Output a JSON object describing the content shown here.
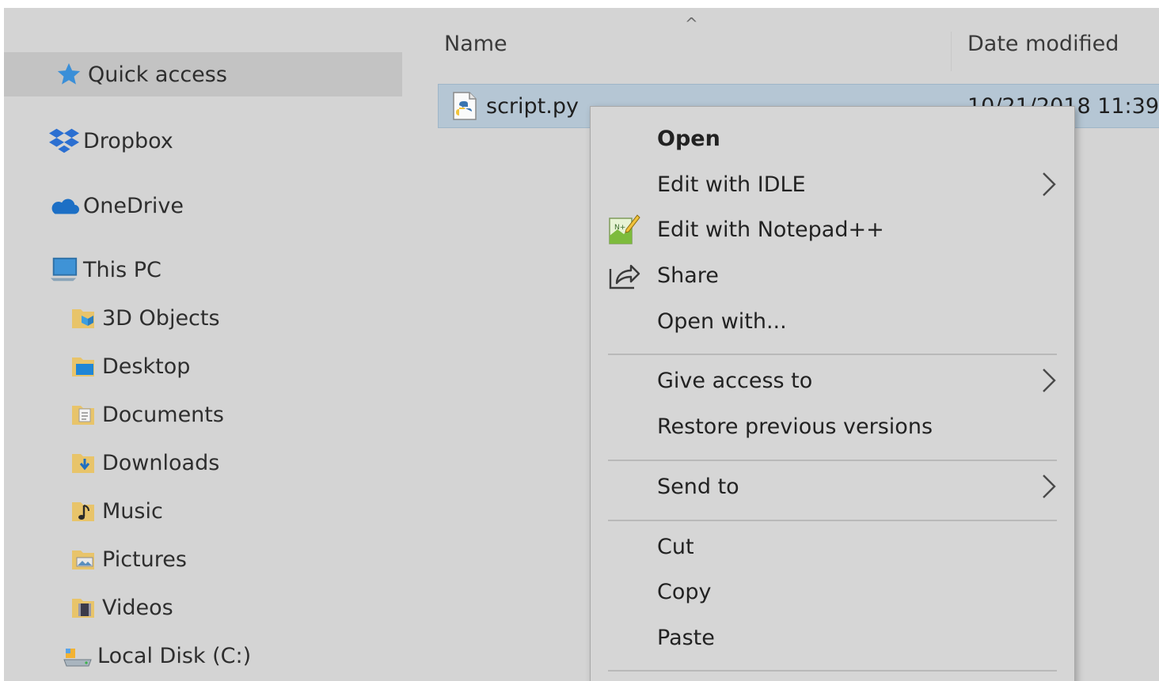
{
  "nav": {
    "items": [
      {
        "label": "Quick access",
        "icon": "star-icon",
        "selected": true
      },
      {
        "label": "Dropbox",
        "icon": "dropbox-icon"
      },
      {
        "label": "OneDrive",
        "icon": "onedrive-cloud-icon"
      },
      {
        "label": "This PC",
        "icon": "computer-icon"
      },
      {
        "label": "3D Objects",
        "icon": "3d-objects-folder-icon"
      },
      {
        "label": "Desktop",
        "icon": "desktop-folder-icon"
      },
      {
        "label": "Documents",
        "icon": "documents-folder-icon"
      },
      {
        "label": "Downloads",
        "icon": "downloads-folder-icon"
      },
      {
        "label": "Music",
        "icon": "music-folder-icon"
      },
      {
        "label": "Pictures",
        "icon": "pictures-folder-icon"
      },
      {
        "label": "Videos",
        "icon": "videos-folder-icon"
      },
      {
        "label": "Local Disk (C:)",
        "icon": "local-disk-icon"
      }
    ]
  },
  "list": {
    "columns": {
      "name": "Name",
      "date_modified": "Date modified"
    },
    "sort_indicator": "^",
    "rows": [
      {
        "name": "script.py",
        "date_modified": "10/21/2018 11:39",
        "icon": "python-file-icon"
      }
    ]
  },
  "context_menu": {
    "items": [
      {
        "label": "Open",
        "bold": true
      },
      {
        "label": "Edit with IDLE",
        "submenu": true
      },
      {
        "label": "Edit with Notepad++",
        "icon": "notepad-plus-plus-icon"
      },
      {
        "label": "Share",
        "icon": "share-icon"
      },
      {
        "label": "Open with..."
      },
      {
        "label": "Give access to",
        "submenu": true
      },
      {
        "label": "Restore previous versions"
      },
      {
        "label": "Send to",
        "submenu": true
      },
      {
        "label": "Cut"
      },
      {
        "label": "Copy"
      },
      {
        "label": "Paste"
      }
    ]
  },
  "colors": {
    "window_bg": "#d4d4d4",
    "selected_nav_bg": "#c3c3c3",
    "selected_row_bg": "#b5c6d4",
    "menu_bg": "#d6d6d6"
  }
}
